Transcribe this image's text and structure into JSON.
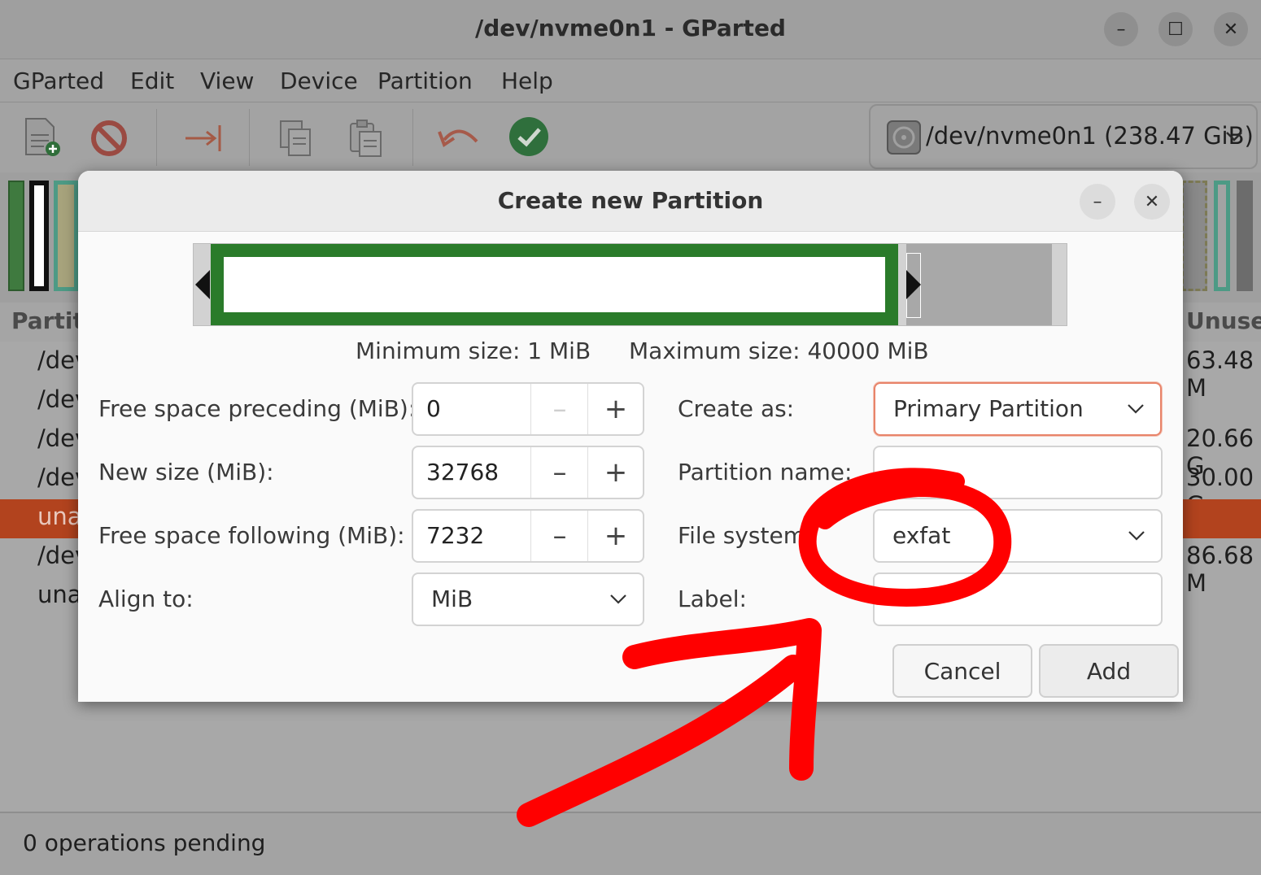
{
  "window": {
    "title": "/dev/nvme0n1 - GParted",
    "controls": {
      "minimize": "–",
      "maximize": "☐",
      "close": "✕"
    }
  },
  "menubar": [
    "GParted",
    "Edit",
    "View",
    "Device",
    "Partition",
    "Help"
  ],
  "toolbar": {
    "icons": [
      "new-partition-icon",
      "delete-icon",
      "resize-move-icon",
      "copy-icon",
      "paste-icon",
      "undo-icon",
      "apply-icon"
    ],
    "device_selector": "/dev/nvme0n1 (238.47 GiB)"
  },
  "partition_list": {
    "header_first": "Partiti",
    "header_last": "Unused",
    "rows": [
      {
        "name": "/dev",
        "unused": "63.48 M"
      },
      {
        "name": "/dev",
        "unused": ""
      },
      {
        "name": "/dev",
        "unused": "20.66 G"
      },
      {
        "name": "/dev",
        "unused": "30.00 G"
      },
      {
        "name": "una",
        "unused": ""
      },
      {
        "name": "/dev",
        "unused": "86.68 M"
      },
      {
        "name": "una",
        "unused": ""
      }
    ]
  },
  "status": "0 operations pending",
  "dialog": {
    "title": "Create new Partition",
    "min_size": "Minimum size: 1 MiB",
    "max_size": "Maximum size: 40000 MiB",
    "new_size_fraction": 0.8192,
    "left": {
      "preceding_label": "Free space preceding (MiB):",
      "preceding_value": "0",
      "size_label": "New size (MiB):",
      "size_value": "32768",
      "following_label": "Free space following (MiB):",
      "following_value": "7232",
      "align_label": "Align to:",
      "align_value": "MiB"
    },
    "right": {
      "create_as_label": "Create as:",
      "create_as_value": "Primary Partition",
      "name_label": "Partition name:",
      "name_value": "",
      "fs_label": "File system:",
      "fs_value": "exfat",
      "label_label": "Label:",
      "label_value": ""
    },
    "spin_minus": "–",
    "spin_plus": "+",
    "cancel": "Cancel",
    "add": "Add"
  },
  "colors": {
    "unallocated_selected_row": "#b2431e",
    "partition_fill": "#2a7b2a",
    "annotation": "#ff0000",
    "focus_border": "#e8846a"
  }
}
